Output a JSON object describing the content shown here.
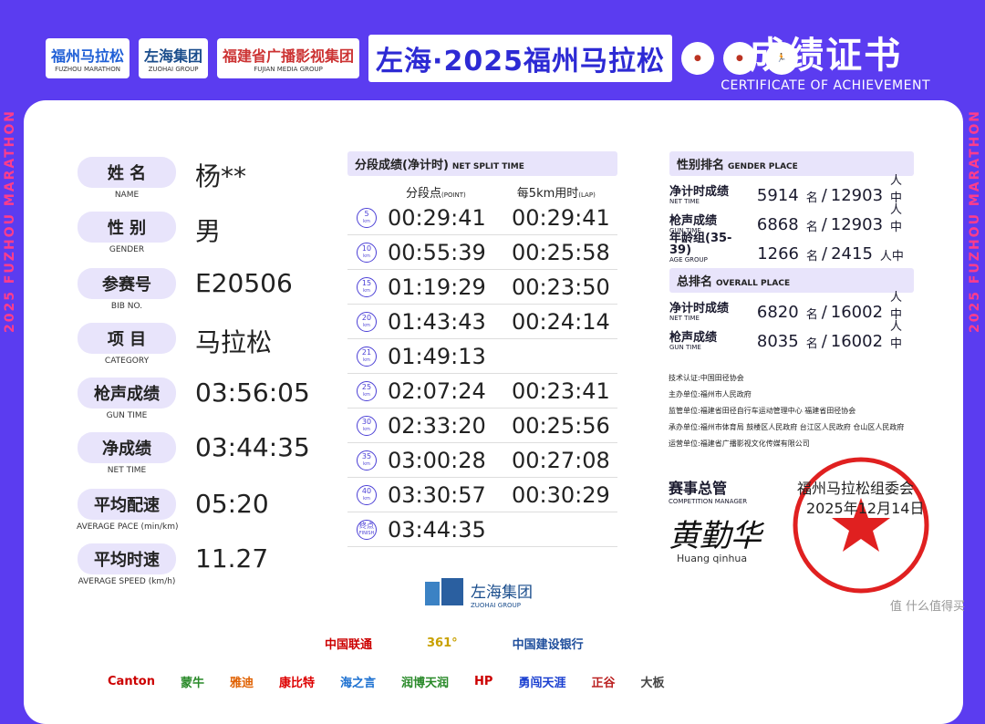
{
  "header": {
    "logos": [
      "福州马拉松",
      "左海集团",
      "福建省广播影视集团"
    ],
    "logo_sub": [
      "FUZHOU MARATHON",
      "ZUOHAI GROUP",
      "FUJIAN MEDIA GROUP"
    ],
    "event_title": "左海·2025福州马拉松",
    "cert_cn": "成绩证书",
    "cert_en": "CERTIFICATE OF ACHIEVEMENT",
    "side_text": "2025 FUZHOU MARATHON"
  },
  "info": [
    {
      "cn": "姓 名",
      "en": "NAME",
      "value": "杨**"
    },
    {
      "cn": "性 别",
      "en": "GENDER",
      "value": "男"
    },
    {
      "cn": "参赛号",
      "en": "BIB NO.",
      "value": "E20506"
    },
    {
      "cn": "项 目",
      "en": "CATEGORY",
      "value": "马拉松"
    },
    {
      "cn": "枪声成绩",
      "en": "GUN TIME",
      "value": "03:56:05"
    },
    {
      "cn": "净成绩",
      "en": "NET TIME",
      "value": "03:44:35"
    },
    {
      "cn": "平均配速",
      "en": "AVERAGE PACE (min/km)",
      "value": "05:20"
    },
    {
      "cn": "平均时速",
      "en": "AVERAGE SPEED (km/h)",
      "value": "11.27"
    }
  ],
  "split": {
    "title_cn": "分段成绩(净计时)",
    "title_en": "NET SPLIT TIME",
    "col_point": "分段点",
    "col_point_en": "(POINT)",
    "col_lap": "每5km用时",
    "col_lap_en": "(LAP)",
    "rows": [
      {
        "km": "5",
        "unit": "km",
        "point": "00:29:41",
        "lap": "00:29:41"
      },
      {
        "km": "10",
        "unit": "km",
        "point": "00:55:39",
        "lap": "00:25:58"
      },
      {
        "km": "15",
        "unit": "km",
        "point": "01:19:29",
        "lap": "00:23:50"
      },
      {
        "km": "20",
        "unit": "km",
        "point": "01:43:43",
        "lap": "00:24:14"
      },
      {
        "km": "21",
        "unit": "km",
        "point": "01:49:13",
        "lap": ""
      },
      {
        "km": "25",
        "unit": "km",
        "point": "02:07:24",
        "lap": "00:23:41"
      },
      {
        "km": "30",
        "unit": "km",
        "point": "02:33:20",
        "lap": "00:25:56"
      },
      {
        "km": "35",
        "unit": "km",
        "point": "03:00:28",
        "lap": "00:27:08"
      },
      {
        "km": "40",
        "unit": "km",
        "point": "03:30:57",
        "lap": "00:30:29"
      },
      {
        "km": "终点",
        "unit": "FINISH",
        "point": "03:44:35",
        "lap": ""
      }
    ]
  },
  "gender_place": {
    "title_cn": "性别排名",
    "title_en": "GENDER PLACE",
    "rows": [
      {
        "cn": "净计时成绩",
        "en": "NET TIME",
        "rank": "5914",
        "total": "12903"
      },
      {
        "cn": "枪声成绩",
        "en": "GUN TIME",
        "rank": "6868",
        "total": "12903"
      },
      {
        "cn": "年龄组(35-39)",
        "en": "AGE GROUP",
        "rank": "1266",
        "total": "2415"
      }
    ]
  },
  "overall_place": {
    "title_cn": "总排名",
    "title_en": "OVERALL PLACE",
    "rows": [
      {
        "cn": "净计时成绩",
        "en": "NET TIME",
        "rank": "6820",
        "total": "16002"
      },
      {
        "cn": "枪声成绩",
        "en": "GUN TIME",
        "rank": "8035",
        "total": "16002"
      }
    ]
  },
  "rank_unit": "名",
  "rank_people": "人中",
  "organizers": [
    "技术认证:中国田径协会",
    "主办单位:福州市人民政府",
    "监管单位:福建省田径自行车运动管理中心 福建省田径协会",
    "承办单位:福州市体育局 鼓楼区人民政府 台江区人民政府 仓山区人民政府",
    "运营单位:福建省广播影视文化传媒有限公司"
  ],
  "manager": {
    "cn": "赛事总管",
    "en": "COMPETITION MANAGER",
    "signature": "黄勤华",
    "name": "Huang qinhua"
  },
  "stamp": {
    "org": "福州马拉松组委会",
    "date": "2025年12月14日"
  },
  "sponsors": {
    "main_cn": "左海集团",
    "main_en": "ZUOHAI GROUP",
    "row1": [
      "中国联通",
      "361°",
      "中国建设银行"
    ],
    "row2": [
      "Canton",
      "蒙牛",
      "雅迪",
      "康比特",
      "海之言",
      "润博天润",
      "HP",
      "勇闯天涯",
      "正谷",
      "大板"
    ]
  },
  "watermark": "值 什么值得买",
  "colors": {
    "brand": "#5b3cf0",
    "accent": "#ff3d8b",
    "pill": "#e8e4fb",
    "stamp": "#e02020"
  }
}
